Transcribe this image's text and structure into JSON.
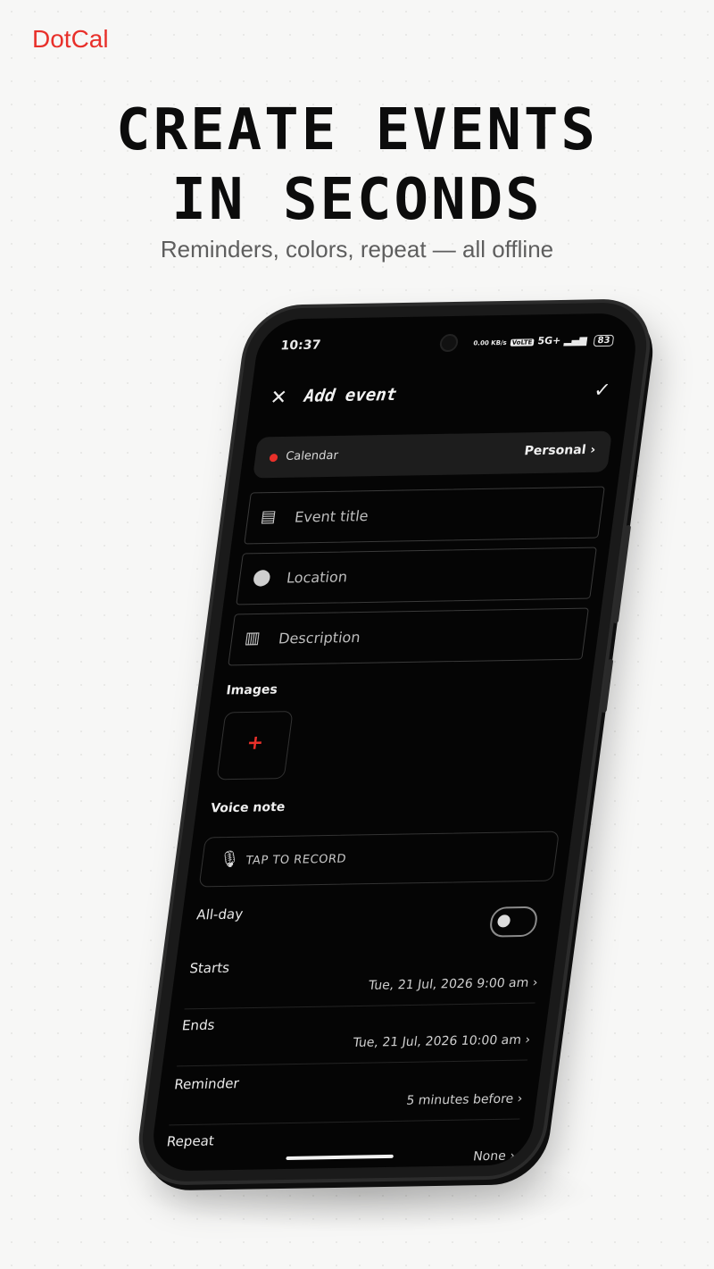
{
  "brand": "DotCal",
  "headline": [
    "CREATE EVENTS",
    "IN SECONDS"
  ],
  "subtitle": "Reminders, colors, repeat — all offline",
  "status_bar": {
    "time": "10:37",
    "speed": "0.00 KB/s",
    "volte": "VoLTE",
    "network": "5G+",
    "battery": "83"
  },
  "app_bar": {
    "title": "Add event",
    "close_icon": "close-icon",
    "confirm_icon": "check-icon"
  },
  "calendar": {
    "label": "Calendar",
    "value": "Personal",
    "dot_color": "#e8302a"
  },
  "fields": {
    "title_placeholder": "Event title",
    "location_placeholder": "Location",
    "description_placeholder": "Description"
  },
  "images": {
    "label": "Images",
    "add_icon": "+"
  },
  "voice_note": {
    "label": "Voice note",
    "action": "TAP TO RECORD"
  },
  "all_day": {
    "label": "All-day",
    "on": false
  },
  "starts": {
    "label": "Starts",
    "value": "Tue, 21 Jul, 2026 9:00 am"
  },
  "ends": {
    "label": "Ends",
    "value": "Tue, 21 Jul, 2026 10:00 am"
  },
  "reminder": {
    "label": "Reminder",
    "value": "5 minutes before"
  },
  "repeat": {
    "label": "Repeat",
    "value": "None"
  },
  "colors": {
    "accent": "#e8302a",
    "screen_bg": "#050505",
    "page_bg": "#f7f7f6"
  }
}
